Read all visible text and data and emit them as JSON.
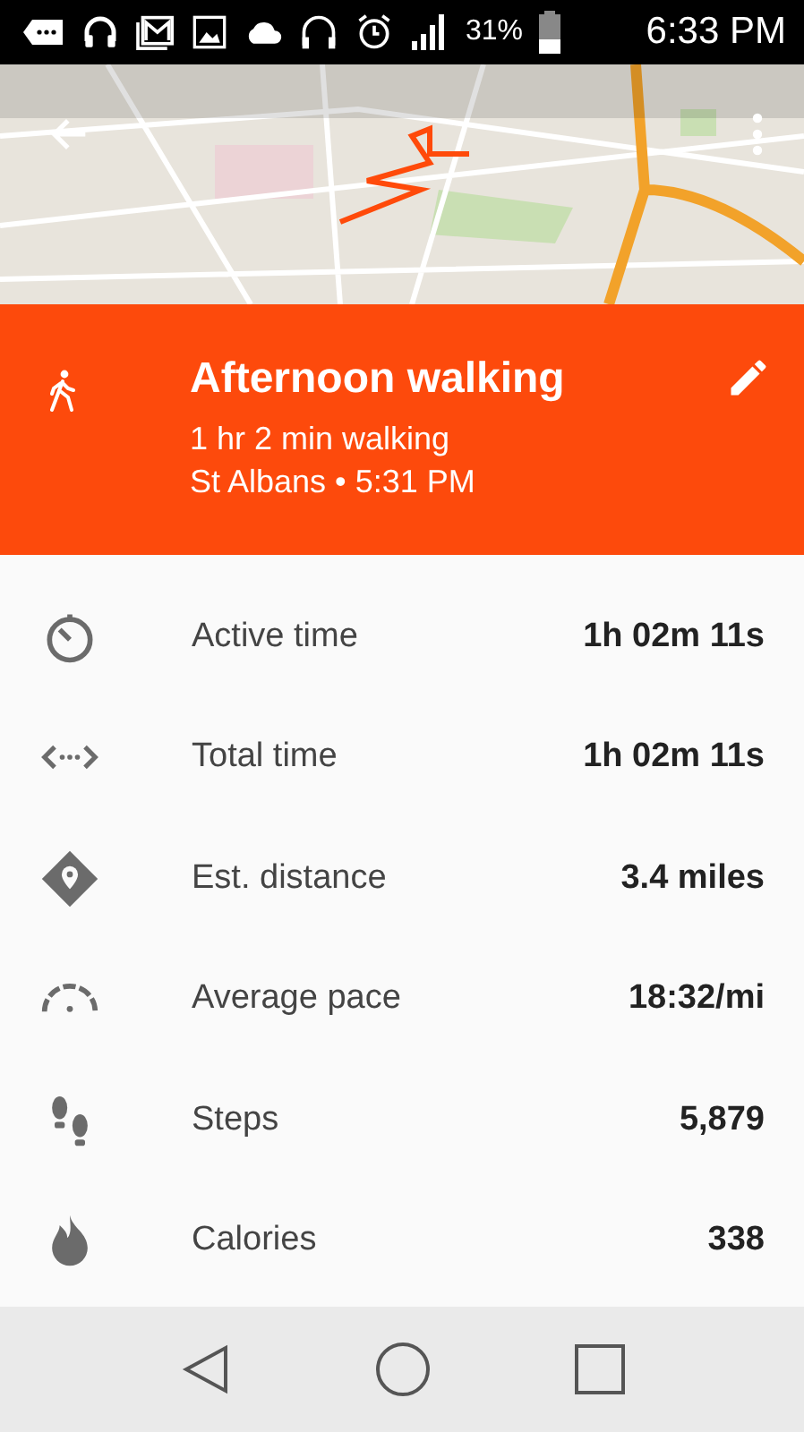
{
  "status_bar": {
    "battery_percent": "31%",
    "time": "6:33 PM"
  },
  "activity": {
    "title": "Afternoon walking",
    "summary": "1 hr 2 min walking",
    "place_time": "St Albans • 5:31 PM"
  },
  "stats": [
    {
      "kind": "timer",
      "label": "Active time",
      "value": "1h 02m 11s"
    },
    {
      "kind": "duration",
      "label": "Total time",
      "value": "1h 02m 11s"
    },
    {
      "kind": "distance",
      "label": "Est. distance",
      "value": "3.4 miles"
    },
    {
      "kind": "pace",
      "label": "Average pace",
      "value": "18:32/mi"
    },
    {
      "kind": "steps",
      "label": "Steps",
      "value": "5,879"
    },
    {
      "kind": "calories",
      "label": "Calories",
      "value": "338"
    }
  ]
}
